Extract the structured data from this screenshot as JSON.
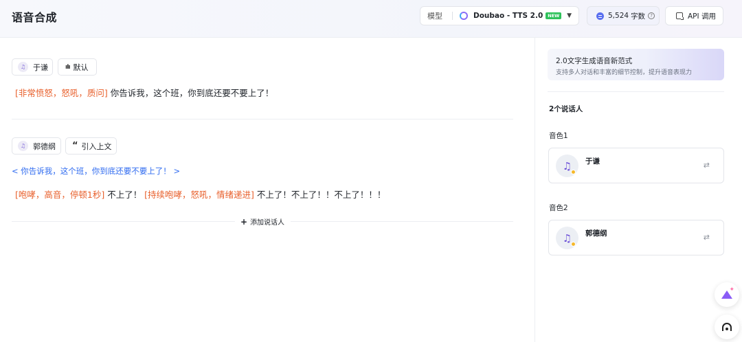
{
  "header": {
    "title": "语音合成",
    "model_label": "模型",
    "model_name": "Doubao - TTS 2.0",
    "model_badge": "NEW",
    "chars_count": "5,524",
    "chars_unit": "字数",
    "api_label": "API 调用"
  },
  "main": {
    "speaker1": {
      "name": "于谦",
      "style_chip": "默认",
      "tag": "[非常愤怒，怒吼，质问]",
      "text": "你告诉我，这个班，你到底还要不要上了！"
    },
    "speaker2": {
      "name": "郭德纲",
      "context_chip": "引入上文",
      "reference_text": "<  你告诉我，这个班，你到底还要不要上了！    >",
      "tag1": "[咆哮，高音，停顿1秒]",
      "text1": " 不上了！ ",
      "tag2": "[持续咆哮，怒吼，情绪递进]",
      "text2": " 不上了！不上了！！不上了！！！"
    },
    "add_speaker_label": "添加说话人"
  },
  "sidebar": {
    "promo_title": "2.0文字生成语音新范式",
    "promo_subtitle": "支持多人对话和丰富的细节控制，提升语音表现力",
    "speakers_count": "2个说话人",
    "voices": [
      {
        "label": "音色1",
        "name": "于谦"
      },
      {
        "label": "音色2",
        "name": "郭德纲"
      }
    ]
  },
  "colors": {
    "accent_blue": "#2f6bf0",
    "tag_orange": "#e8602c",
    "new_badge": "#2fc25b"
  }
}
